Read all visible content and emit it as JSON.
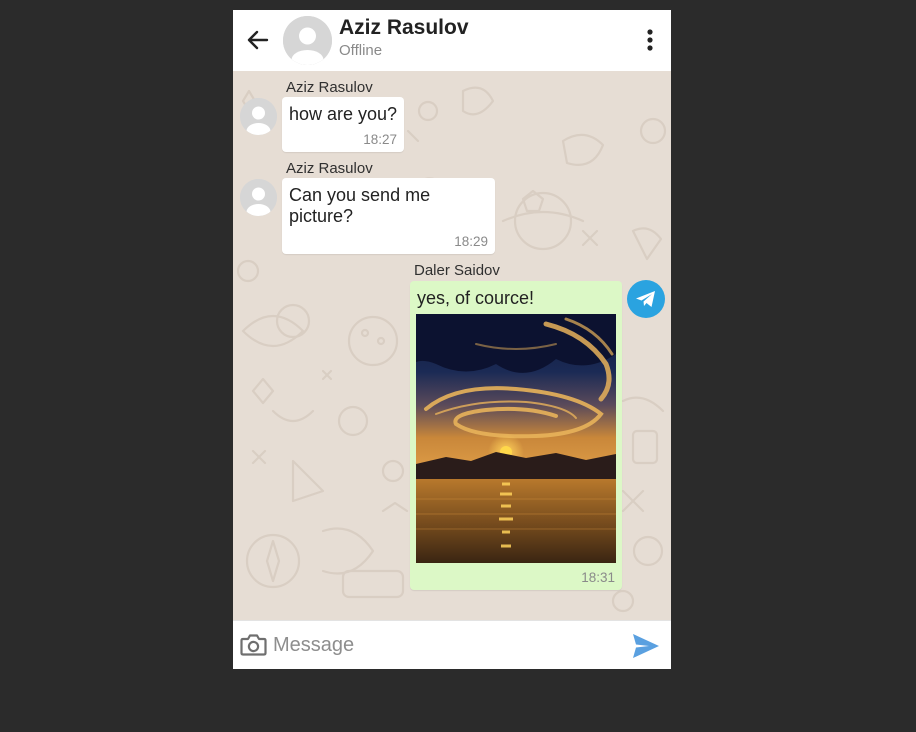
{
  "header": {
    "contact_name": "Aziz Rasulov",
    "status": "Offline"
  },
  "messages": [
    {
      "sender": "Aziz Rasulov",
      "text": "how are you?",
      "time": "18:27",
      "direction": "incoming"
    },
    {
      "sender": "Aziz Rasulov",
      "text": "Can you send me picture?",
      "time": "18:29",
      "direction": "incoming"
    },
    {
      "sender": "Daler Saidov",
      "text": "yes, of cource!",
      "time": "18:31",
      "direction": "outgoing",
      "attachment": "sunset-photo"
    }
  ],
  "input": {
    "placeholder": "Message",
    "value": ""
  },
  "icons": {
    "back": "arrow-left-icon",
    "menu": "kebab-menu-icon",
    "avatar": "default-user-avatar",
    "badge": "telegram-icon",
    "camera": "camera-icon",
    "send": "send-icon"
  },
  "colors": {
    "page_background": "#2b2b2b",
    "chat_background": "#e6ddd4",
    "incoming_bubble": "#ffffff",
    "outgoing_bubble": "#dcf8c6",
    "send_accent": "#5aa0e0",
    "telegram_badge": "#2aa3e0"
  }
}
